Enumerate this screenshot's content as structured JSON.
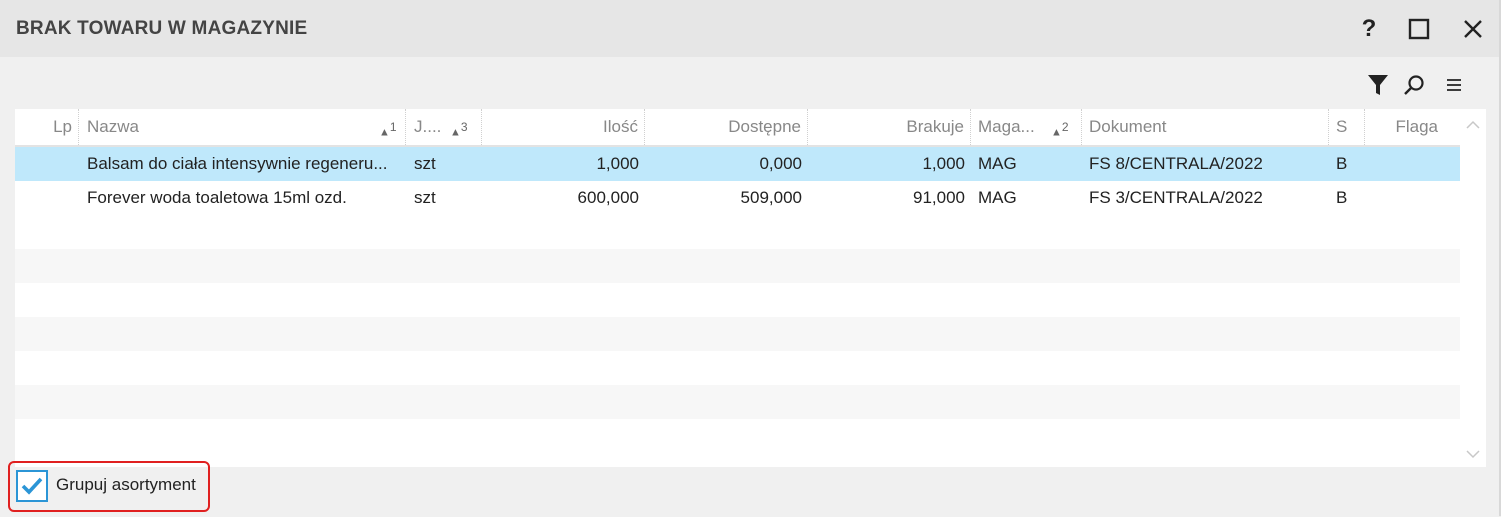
{
  "window": {
    "title": "BRAK TOWARU W MAGAZYNIE",
    "help_label": "?"
  },
  "toolbar": {
    "icons": [
      "filter-icon",
      "search-icon",
      "menu-icon"
    ]
  },
  "table": {
    "columns": {
      "lp": "Lp",
      "nazwa": "Nazwa",
      "nazwa_sort": "1",
      "jm": "J....",
      "jm_sort": "3",
      "ilosc": "Ilość",
      "dostepne": "Dostępne",
      "brakuje": "Brakuje",
      "magazyn": "Maga...",
      "magazyn_sort": "2",
      "dokument": "Dokument",
      "s": "S",
      "flaga": "Flaga"
    },
    "rows": [
      {
        "lp": "",
        "nazwa": "Balsam do ciała intensywnie regeneru...",
        "jm": "szt",
        "ilosc": "1,000",
        "dostepne": "0,000",
        "brakuje": "1,000",
        "magazyn": "MAG",
        "dokument": "FS 8/CENTRALA/2022",
        "s": "B",
        "flaga": ""
      },
      {
        "lp": "",
        "nazwa": "Forever woda toaletowa 15ml ozd.",
        "jm": "szt",
        "ilosc": "600,000",
        "dostepne": "509,000",
        "brakuje": "91,000",
        "magazyn": "MAG",
        "dokument": "FS 3/CENTRALA/2022",
        "s": "B",
        "flaga": ""
      }
    ]
  },
  "footer": {
    "group_checkbox_label": "Grupuj asortyment",
    "group_checked": true
  },
  "colors": {
    "selected_row": "#bfe8fb",
    "checkbox_accent": "#2b95d6",
    "highlight_border": "#e02020"
  }
}
